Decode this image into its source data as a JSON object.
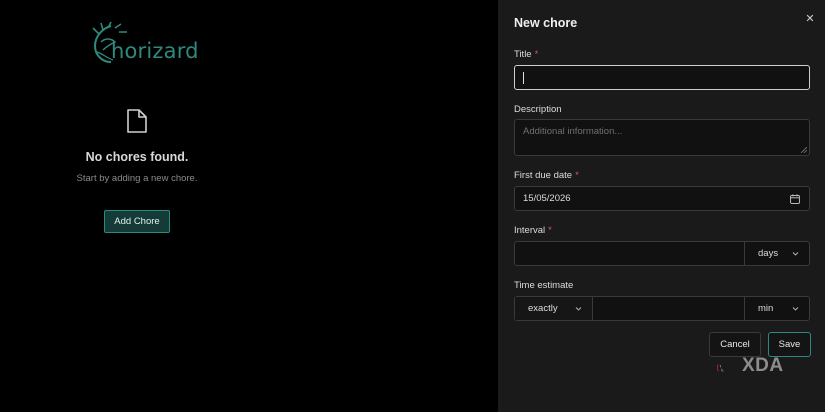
{
  "app": {
    "logo_text": "horizard",
    "empty_title": "No chores found.",
    "empty_subtitle": "Start by adding a new chore.",
    "add_button_label": "Add Chore",
    "empty_icon": "file-icon",
    "accent_color": "#2b8a80"
  },
  "drawer": {
    "title": "New chore",
    "close_icon": "close-icon",
    "close_label": "✕",
    "required_mark": "*",
    "title_field": {
      "label": "Title",
      "value": "",
      "placeholder": ""
    },
    "description_field": {
      "label": "Description",
      "value": "",
      "placeholder": "Additional information..."
    },
    "due_date_field": {
      "label": "First due date",
      "value": "15/05/2026",
      "icon": "calendar-icon"
    },
    "interval_field": {
      "label": "Interval",
      "value": "",
      "unit": "days",
      "unit_icon": "chevron-down-icon"
    },
    "time_estimate_field": {
      "label": "Time estimate",
      "mode": "exactly",
      "value": "",
      "unit": "min"
    },
    "cancel_label": "Cancel",
    "save_label": "Save"
  },
  "watermark": {
    "text": "XDA"
  }
}
